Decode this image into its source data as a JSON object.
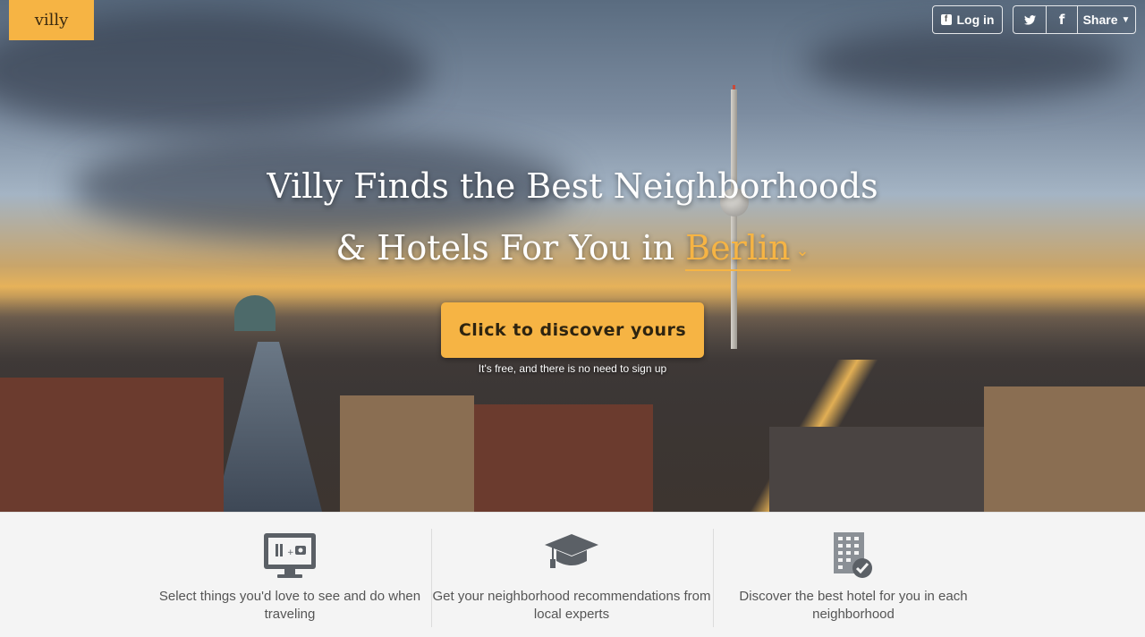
{
  "brand": {
    "logo": "villy",
    "accent": "#f6b444"
  },
  "topnav": {
    "login_label": "Log in",
    "share_label": "Share",
    "twitter_icon": "twitter-icon",
    "facebook_icon": "facebook-icon"
  },
  "hero": {
    "line1": "Villy Finds the Best Neighborhoods",
    "line2_prefix": "& Hotels For You in",
    "city": "Berlin",
    "cta_label": "Click to discover yours",
    "cta_note": "It's free, and there is no need to sign up"
  },
  "features": [
    {
      "icon": "monitor-food-camera-icon",
      "text": "Select things you'd love to see and do when traveling"
    },
    {
      "icon": "graduation-cap-icon",
      "text": "Get your neighborhood recommendations from local experts"
    },
    {
      "icon": "hotel-check-icon",
      "text": "Discover the best hotel for you in each neighborhood"
    }
  ]
}
